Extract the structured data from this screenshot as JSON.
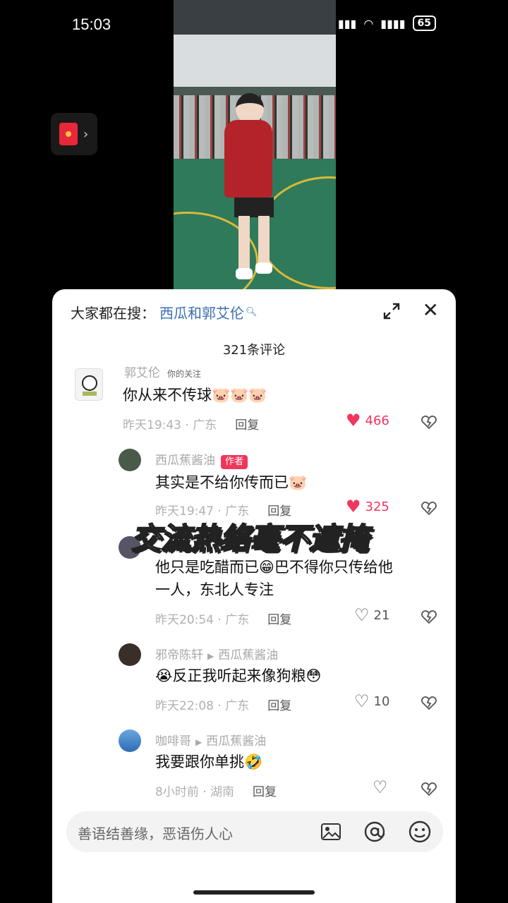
{
  "status": {
    "time": "15:03",
    "battery": "65"
  },
  "sheet": {
    "search_label": "大家都在搜：",
    "search_term": "西瓜和郭艾伦",
    "comment_count": "321条评论",
    "overlay_caption": "交流热络毫不遮掩",
    "input_placeholder": "善语结善缘，恶语伤人心"
  },
  "comments": [
    {
      "nick": "郭艾伦",
      "tag": "你的关注",
      "text": "你从来不传球🐷🐷🐷",
      "meta": "昨天19:43 · 广东",
      "reply": "回复",
      "likes": "466",
      "liked": true
    },
    {
      "nick": "西瓜蕉酱油",
      "badge": "作者",
      "text": "其实是不给你传而已🐷",
      "meta": "昨天19:47 · 广东",
      "reply": "回复",
      "likes": "325",
      "liked": true
    },
    {
      "nick": "",
      "text_line1": "他只是吃醋而已😁巴不得你只传给他",
      "text_line2": "一人，东北人专注",
      "meta": "昨天20:54 · 广东",
      "reply": "回复",
      "likes": "21"
    },
    {
      "nick": "邪帝陈轩",
      "reply_to": "西瓜蕉酱油",
      "text": "😭反正我听起来像狗粮😳",
      "meta": "昨天22:08 · 广东",
      "reply": "回复",
      "likes": "10"
    },
    {
      "nick": "咖啡哥",
      "reply_to": "西瓜蕉酱油",
      "text": "我要跟你单挑🤣",
      "meta": "8小时前 · 湖南",
      "reply": "回复",
      "likes": ""
    }
  ],
  "icons": [
    "red-packet-icon",
    "expand-icon",
    "close-icon",
    "heart-icon",
    "dislike-icon",
    "image-icon",
    "at-icon",
    "emoji-icon"
  ],
  "colors": {
    "accent": "#f0365c",
    "link": "#3a6fb0"
  }
}
